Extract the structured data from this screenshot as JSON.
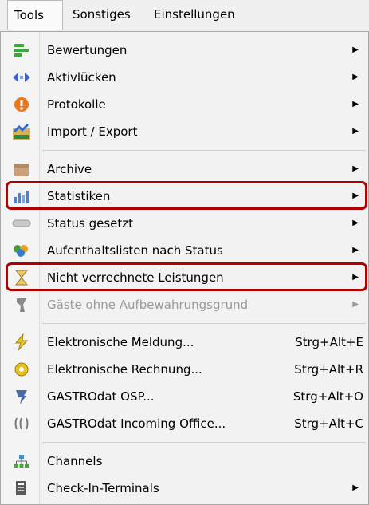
{
  "menubar": {
    "tools": "Tools",
    "sonstiges": "Sonstiges",
    "einstellungen": "Einstellungen"
  },
  "menu": {
    "items": [
      {
        "label": "Bewertungen",
        "icon": "rating-bars-icon"
      },
      {
        "label": "Aktivlücken",
        "icon": "gap-arrows-icon"
      },
      {
        "label": "Protokolle",
        "icon": "protocol-icon"
      },
      {
        "label": "Import / Export",
        "icon": "import-export-icon"
      },
      {
        "label": "Archive",
        "icon": "archive-icon"
      },
      {
        "label": "Statistiken",
        "icon": "statistics-chart-icon"
      },
      {
        "label": "Status gesetzt",
        "icon": "status-bar-icon"
      },
      {
        "label": "Aufenthaltslisten nach Status",
        "icon": "people-list-icon"
      },
      {
        "label": "Nicht verrechnete Leistungen",
        "icon": "hourglass-icon"
      },
      {
        "label": "Gäste ohne Aufbewahrungsgrund",
        "icon": "guest-icon",
        "disabled": true
      },
      {
        "label": "Elektronische Meldung...",
        "shortcut": "Strg+Alt+E",
        "icon": "lightning-icon"
      },
      {
        "label": "Elektronische Rechnung...",
        "shortcut": "Strg+Alt+R",
        "icon": "invoice-icon"
      },
      {
        "label": "GASTROdat OSP...",
        "shortcut": "Strg+Alt+O",
        "icon": "gastrodat-osp-icon"
      },
      {
        "label": "GASTROdat Incoming Office...",
        "shortcut": "Strg+Alt+C",
        "icon": "incoming-office-icon"
      },
      {
        "label": "Channels",
        "icon": "channels-icon"
      },
      {
        "label": "Check-In-Terminals",
        "icon": "terminal-icon"
      }
    ]
  },
  "colors": {
    "highlight_border": "#b00000",
    "disabled_text": "#9a9a9a"
  }
}
